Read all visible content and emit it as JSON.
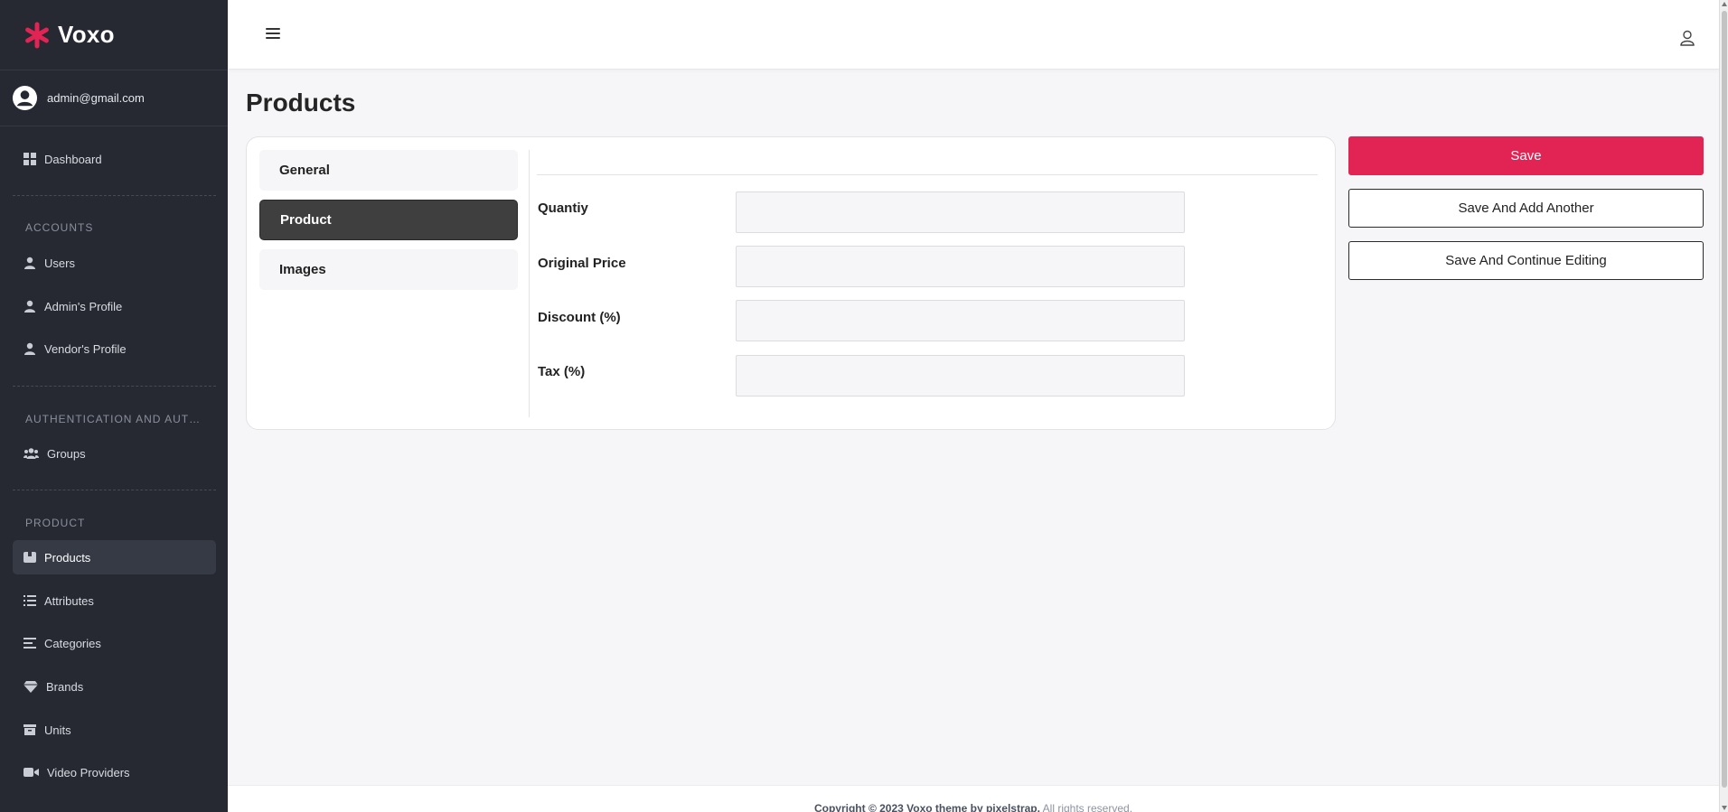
{
  "brand": {
    "name": "Voxo",
    "accent_color": "#e22454"
  },
  "user": {
    "email": "admin@gmail.com"
  },
  "sidebar": {
    "dashboard": {
      "label": "Dashboard",
      "icon": "grid-icon"
    },
    "sections": {
      "accounts": "ACCOUNTS",
      "auth": "AUTHENTICATION AND AUTHORIZATION",
      "product": "PRODUCT"
    },
    "accounts_items": [
      {
        "label": "Users",
        "icon": "user-icon"
      },
      {
        "label": "Admin's Profile",
        "icon": "user-icon"
      },
      {
        "label": "Vendor's Profile",
        "icon": "user-icon"
      }
    ],
    "auth_items": [
      {
        "label": "Groups",
        "icon": "users-group-icon"
      }
    ],
    "product_items": [
      {
        "label": "Products",
        "icon": "box-icon",
        "active": true
      },
      {
        "label": "Attributes",
        "icon": "list-icon"
      },
      {
        "label": "Categories",
        "icon": "bars-icon"
      },
      {
        "label": "Brands",
        "icon": "gem-icon"
      },
      {
        "label": "Units",
        "icon": "archive-icon"
      },
      {
        "label": "Video Providers",
        "icon": "video-icon"
      }
    ]
  },
  "page": {
    "title": "Products"
  },
  "tabs": [
    {
      "label": "General",
      "active": false
    },
    {
      "label": "Product",
      "active": true
    },
    {
      "label": "Images",
      "active": false
    }
  ],
  "form": {
    "fields": [
      {
        "label": "Quantiy",
        "value": ""
      },
      {
        "label": "Original Price",
        "value": ""
      },
      {
        "label": "Discount (%)",
        "value": ""
      },
      {
        "label": "Tax (%)",
        "value": ""
      }
    ]
  },
  "actions": {
    "save": "Save",
    "save_add_another": "Save And Add Another",
    "save_continue": "Save And Continue Editing"
  },
  "footer": {
    "copyright": "Copyright © 2023 Voxo theme by pixelstrap.",
    "rights": "All rights reserved."
  }
}
